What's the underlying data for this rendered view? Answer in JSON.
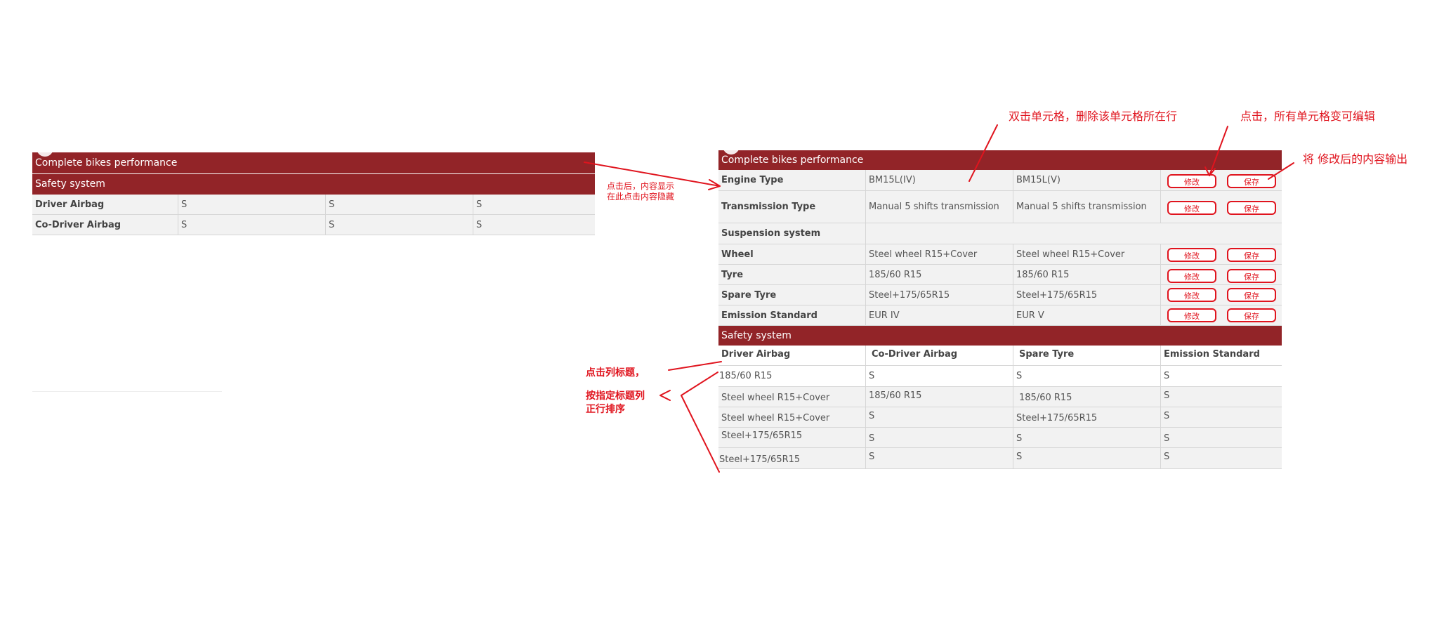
{
  "left_panel": {
    "header": "Complete bikes performance",
    "section": "Safety system",
    "rows": [
      {
        "label": "Driver Airbag",
        "values": [
          "S",
          "S",
          "S"
        ]
      },
      {
        "label": "Co-Driver Airbag",
        "values": [
          "S",
          "S",
          "S"
        ]
      }
    ]
  },
  "right_panel": {
    "header": "Complete bikes performance",
    "rows": [
      {
        "label": "Engine Type",
        "v1": "BM15L(IV)",
        "v2": "BM15L(V)",
        "edit": "修改",
        "save": "保存"
      },
      {
        "label": "Transmission Type",
        "v1": "Manual 5 shifts transmission",
        "v2": "Manual 5 shifts transmission",
        "edit": "修改",
        "save": "保存"
      },
      {
        "label": "Suspension system"
      },
      {
        "label": "Wheel",
        "v1": "Steel wheel R15+Cover",
        "v2": "Steel wheel R15+Cover",
        "edit": "修改",
        "save": "保存"
      },
      {
        "label": "Tyre",
        "v1": "185/60 R15",
        "v2": "185/60 R15",
        "edit": "修改",
        "save": "保存"
      },
      {
        "label": "Spare Tyre",
        "v1": "Steel+175/65R15",
        "v2": "Steel+175/65R15",
        "edit": "修改",
        "save": "保存"
      },
      {
        "label": "Emission Standard",
        "v1": "EUR IV",
        "v2": "EUR V",
        "edit": "修改",
        "save": "保存"
      }
    ],
    "section": "Safety system",
    "columns": [
      "Driver Airbag",
      "Co-Driver Airbag",
      "Spare Tyre",
      "Emission Standard"
    ],
    "data_rows": [
      [
        "185/60 R15",
        "S",
        "S",
        "S"
      ],
      [
        "Steel wheel R15+Cover",
        "185/60 R15",
        "185/60 R15",
        "S"
      ],
      [
        "Steel wheel R15+Cover",
        "S",
        "Steel+175/65R15",
        "S"
      ],
      [
        "Steel+175/65R15",
        "S",
        "S",
        "S"
      ],
      [
        "Steel+175/65R15",
        "S",
        "S",
        "S"
      ]
    ]
  },
  "annotations": {
    "toggle_note": [
      "点击后，内容显示",
      "在此点击内容隐藏"
    ],
    "delete_note": "双击单元格，删除该单元格所在行",
    "edit_note": "点击，所有单元格变可编辑",
    "output_note": "将 修改后的内容输出",
    "sort_note_1": "点击列标题，",
    "sort_note_2": [
      "按指定标题列",
      "正行排序"
    ]
  },
  "colors": {
    "header_bg": "#922428",
    "row_bg": "#f2f2f2",
    "annotation": "#e0141e"
  }
}
